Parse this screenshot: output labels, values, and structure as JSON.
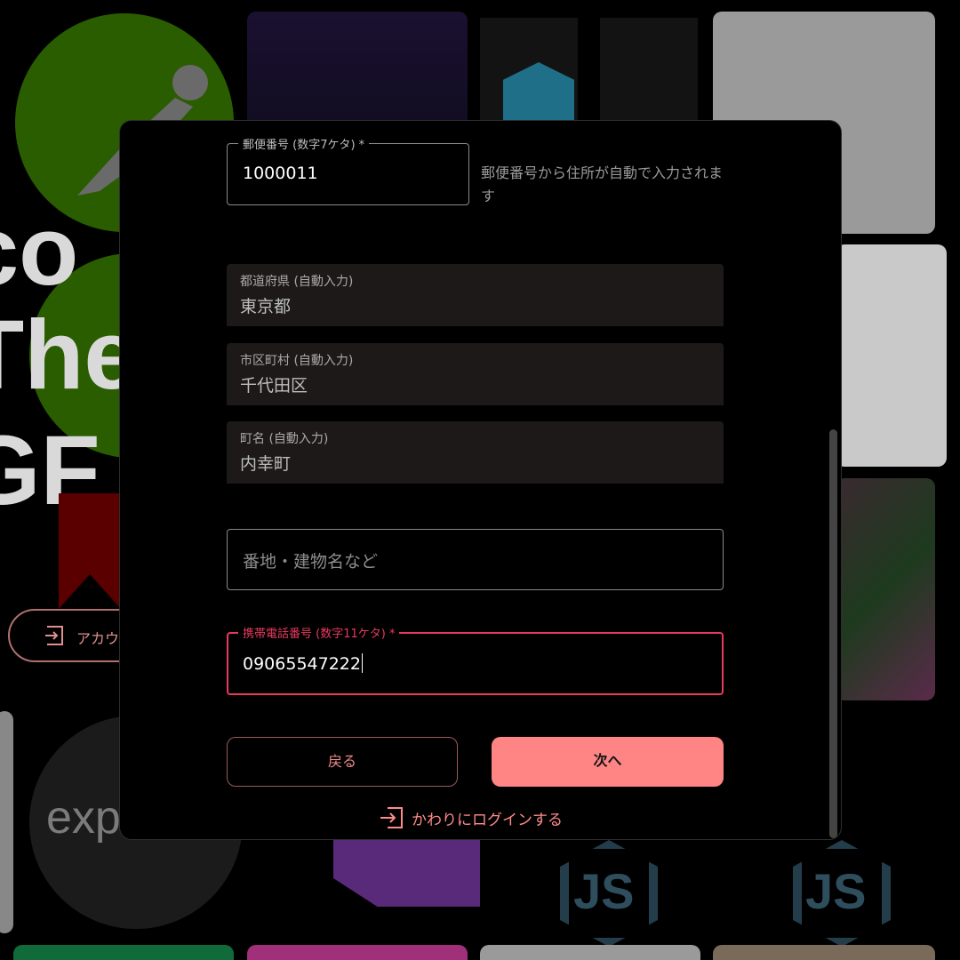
{
  "background": {
    "big_text_lines": [
      "co",
      "The",
      "GF"
    ],
    "expo_text": "exp",
    "node_text": "JS",
    "login_pill_text": "アカウ"
  },
  "form": {
    "postal": {
      "legend": "郵便番号 (数字7ケタ) *",
      "value": "1000011",
      "helper": "郵便番号から住所が自動で入力されます"
    },
    "prefecture": {
      "label": "都道府県 (自動入力)",
      "value": "東京都"
    },
    "city": {
      "label": "市区町村 (自動入力)",
      "value": "千代田区"
    },
    "town": {
      "label": "町名 (自動入力)",
      "value": "内幸町"
    },
    "address_detail": {
      "placeholder": "番地・建物名など"
    },
    "phone": {
      "legend": "携帯電話番号 (数字11ケタ) *",
      "value": "09065547222"
    }
  },
  "buttons": {
    "back": "戻る",
    "next": "次へ"
  },
  "login_link": {
    "label": "かわりにログインする",
    "icon": "login-icon"
  },
  "colors": {
    "accent": "#ff8585",
    "focus": "#e8395e",
    "modal_bg": "#000000",
    "filled_bg": "#1d1919"
  }
}
